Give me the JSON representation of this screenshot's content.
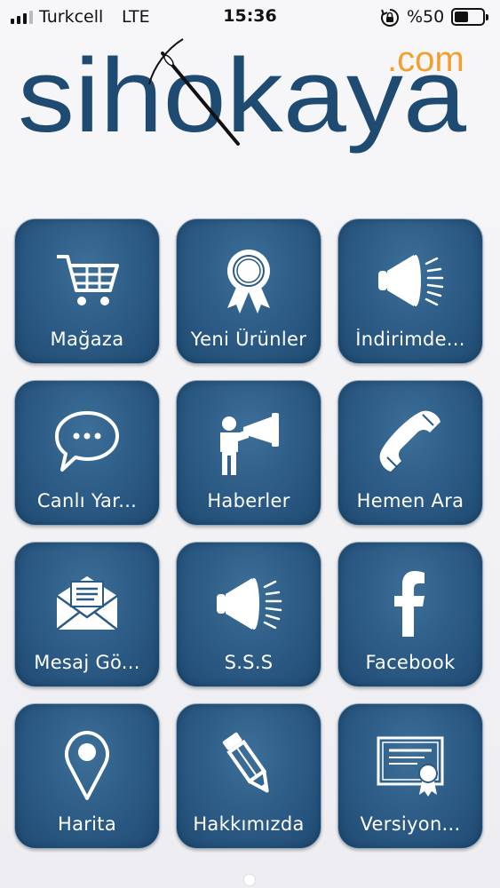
{
  "status_bar": {
    "carrier": "Turkcell",
    "network": "LTE",
    "time": "15:36",
    "battery": "%50",
    "battery_level": 0.5
  },
  "logo": {
    "main": "sihokaya",
    "suffix": ".com",
    "color_main": "#1f4a72",
    "color_suffix": "#f0a030"
  },
  "tiles": [
    {
      "label": "Mağaza",
      "icon": "cart-icon"
    },
    {
      "label": "Yeni Ürünler",
      "icon": "award-ribbon-icon"
    },
    {
      "label": "İndirimde...",
      "icon": "megaphone-icon"
    },
    {
      "label": "Canlı Yar...",
      "icon": "chat-bubble-icon"
    },
    {
      "label": "Haberler",
      "icon": "person-megaphone-icon"
    },
    {
      "label": "Hemen Ara",
      "icon": "phone-icon"
    },
    {
      "label": "Mesaj Gö...",
      "icon": "envelope-icon"
    },
    {
      "label": "S.S.S",
      "icon": "megaphone-icon"
    },
    {
      "label": "Facebook",
      "icon": "facebook-icon"
    },
    {
      "label": "Harita",
      "icon": "map-pin-icon"
    },
    {
      "label": "Hakkımızda",
      "icon": "pencil-icon"
    },
    {
      "label": "Versiyon...",
      "icon": "certificate-icon"
    }
  ],
  "colors": {
    "tile_background": "#2b5a84",
    "tile_border": "#8fa9c2",
    "tile_text": "#ffffff"
  }
}
